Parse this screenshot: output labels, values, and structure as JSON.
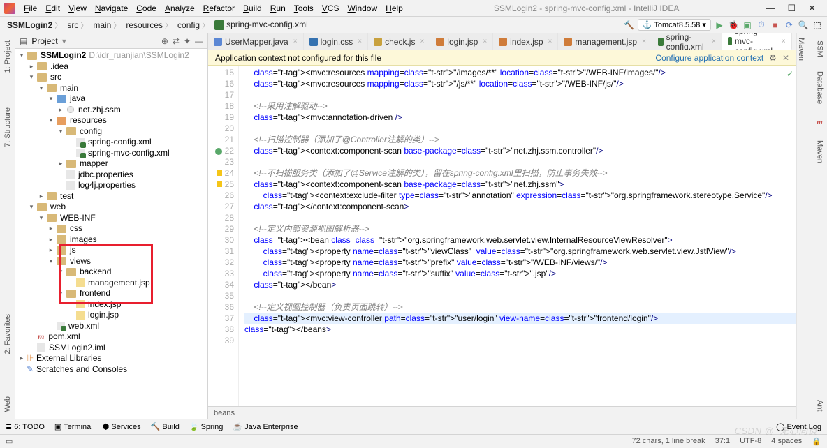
{
  "window": {
    "title": "SSMLogin2 - spring-mvc-config.xml - IntelliJ IDEA",
    "menus": [
      "File",
      "Edit",
      "View",
      "Navigate",
      "Code",
      "Analyze",
      "Refactor",
      "Build",
      "Run",
      "Tools",
      "VCS",
      "Window",
      "Help"
    ]
  },
  "breadcrumbs": [
    "SSMLogin2",
    "src",
    "main",
    "resources",
    "config",
    "spring-mvc-config.xml"
  ],
  "run_config": "Tomcat8.5.58",
  "right_tool": "Maven",
  "project_panel": {
    "title": "Project",
    "root_name": "SSMLogin2",
    "root_path": "D:\\idr_ruanjian\\SSMLogin2",
    "nodes": {
      "idea": ".idea",
      "src": "src",
      "main": "main",
      "java": "java",
      "pkg": "net.zhj.ssm",
      "resources": "resources",
      "config": "config",
      "spring_cfg": "spring-config.xml",
      "mvc_cfg": "spring-mvc-config.xml",
      "mapper": "mapper",
      "jdbc": "jdbc.properties",
      "log4j": "log4j.properties",
      "test": "test",
      "web": "web",
      "webinf": "WEB-INF",
      "css": "css",
      "images": "images",
      "js": "js",
      "views": "views",
      "backend": "backend",
      "mgmt": "management.jsp",
      "frontend": "frontend",
      "index": "index.jsp",
      "login": "login.jsp",
      "webxml": "web.xml",
      "pom": "pom.xml",
      "iml": "SSMLogin2.iml",
      "ext": "External Libraries",
      "scratch": "Scratches and Consoles"
    }
  },
  "editor_tabs": [
    {
      "label": "UserMapper.java",
      "icon": "#5b87d4"
    },
    {
      "label": "login.css",
      "icon": "#3572b0"
    },
    {
      "label": "check.js",
      "icon": "#c8a13e"
    },
    {
      "label": "login.jsp",
      "icon": "#cf7c3a"
    },
    {
      "label": "index.jsp",
      "icon": "#cf7c3a"
    },
    {
      "label": "management.jsp",
      "icon": "#cf7c3a"
    },
    {
      "label": "spring-config.xml",
      "icon": "#3a7a3a"
    },
    {
      "label": "spring-mvc-config.xml",
      "icon": "#3a7a3a",
      "active": true
    }
  ],
  "banner": {
    "text": "Application context not configured for this file",
    "link": "Configure application context"
  },
  "gutter_start": 15,
  "code_lines": [
    "    <mvc:resources mapping=\"/images/**\" location=\"/WEB-INF/images/\"/>",
    "    <mvc:resources mapping=\"/js/**\" location=\"/WEB-INF/js/\"/>",
    "",
    "    <!--采用注解驱动-->",
    "    <mvc:annotation-driven />",
    "",
    "    <!--扫描控制器（添加了@Controller注解的类）-->",
    "    <context:component-scan base-package=\"net.zhj.ssm.controller\"/>",
    "",
    "    <!--不扫描服务类（添加了@Service注解的类），留在spring-config.xml里扫描，防止事务失效-->",
    "    <context:component-scan base-package=\"net.zhj.ssm\">",
    "        <context:exclude-filter type=\"annotation\" expression=\"org.springframework.stereotype.Service\"/>",
    "    </context:component-scan>",
    "",
    "    <!--定义内部资源视图解析器-->",
    "    <bean class=\"org.springframework.web.servlet.view.InternalResourceViewResolver\">",
    "        <property name=\"viewClass\"  value=\"org.springframework.web.servlet.view.JstlView\"/>",
    "        <property name=\"prefix\" value=\"/WEB-INF/views/\"/>",
    "        <property name=\"suffix\" value=\".jsp\"/>",
    "    </bean>",
    "",
    "    <!--定义视图控制器（负责页面跳转）-->",
    "    <mvc:view-controller path=\"user/login\" view-name=\"frontend/login\"/>",
    "</beans>",
    ""
  ],
  "current_line": 37,
  "crumbbar": "beans",
  "bottom_tools": [
    "≣ 6: TODO",
    "Terminal",
    "Services",
    "Build",
    "Spring",
    "Java Enterprise"
  ],
  "event_log": "Event Log",
  "status": {
    "chars": "72 chars, 1 line break",
    "pos": "37:1",
    "enc": "UTF-8",
    "spaces": "4 spaces"
  },
  "left_rail": [
    "1: Project",
    "7: Structure",
    "2: Favorites",
    "Web"
  ],
  "right_rail": [
    "SSM",
    "Database",
    "Maven",
    "Ant"
  ],
  "watermark": "CSDN @_无心向良"
}
